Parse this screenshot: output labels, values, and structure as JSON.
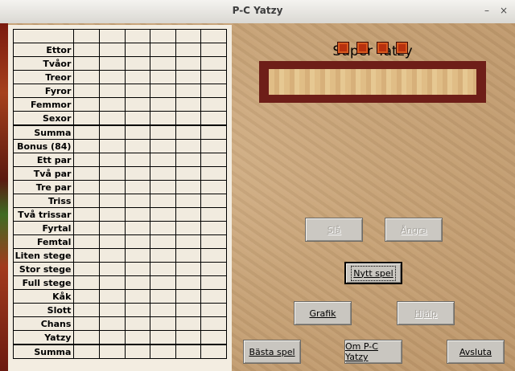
{
  "window": {
    "title": "P-C Yatzy",
    "minimize_glyph": "–",
    "close_glyph": "×"
  },
  "scoresheet": {
    "rows": [
      "Ettor",
      "Tvåor",
      "Treor",
      "Fyror",
      "Femmor",
      "Sexor",
      "Summa",
      "Bonus (84)",
      "Ett par",
      "Två par",
      "Tre par",
      "Triss",
      "Två trissar",
      "Fyrtal",
      "Femtal",
      "Liten stege",
      "Stor stege",
      "Full stege",
      "Kåk",
      "Slott",
      "Chans",
      "Yatzy",
      "Summa"
    ]
  },
  "game": {
    "title": "Super Yatzy",
    "dice_count": 4
  },
  "buttons": {
    "roll": "Slå",
    "undo": "Ångra",
    "new_game": "Nytt spel",
    "graphics": "Grafik",
    "help": "Hjälp",
    "best_games": "Bästa spel",
    "about": "Om P-C Yatzy",
    "quit": "Avsluta"
  }
}
